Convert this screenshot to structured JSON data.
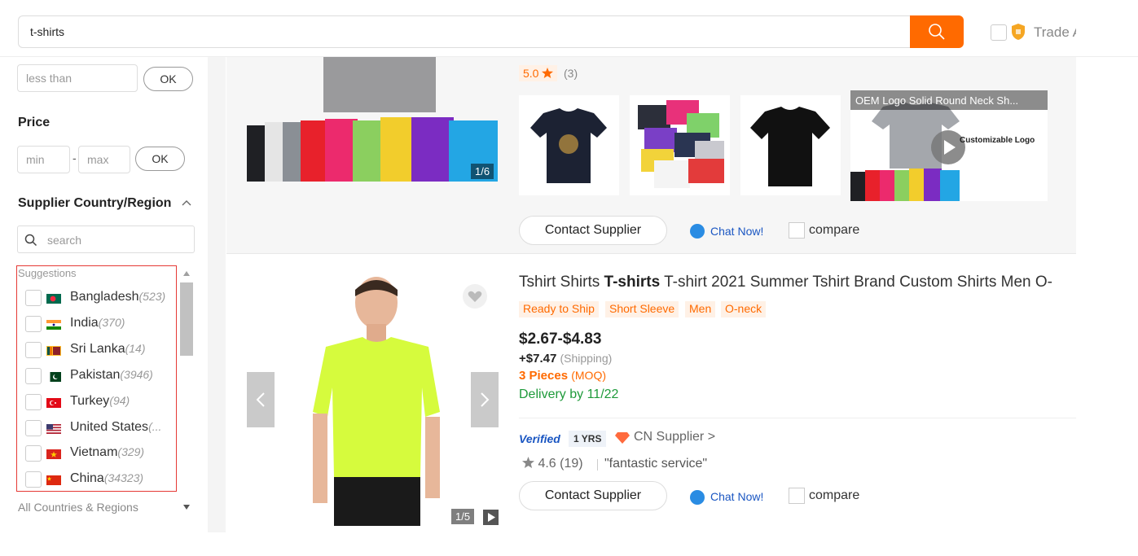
{
  "search": {
    "value": "t-shirts"
  },
  "trade_assurance": {
    "label": "Trade A"
  },
  "sidebar": {
    "min_order_placeholder": "less than",
    "ok_label": "OK",
    "price_title": "Price",
    "min_placeholder": "min",
    "max_placeholder": "max",
    "dash": "-",
    "country_title": "Supplier Country/Region",
    "country_search_placeholder": "search",
    "suggestions_title": "Suggestions",
    "countries": [
      {
        "name": "Bangladesh",
        "count": "(523)",
        "flag": "bangladesh"
      },
      {
        "name": "India",
        "count": "(370)",
        "flag": "india"
      },
      {
        "name": "Sri Lanka",
        "count": "(14)",
        "flag": "sri-lanka"
      },
      {
        "name": "Pakistan",
        "count": "(3946)",
        "flag": "pakistan"
      },
      {
        "name": "Turkey",
        "count": "(94)",
        "flag": "turkey"
      },
      {
        "name": "United States",
        "count": "(...",
        "flag": "united-states"
      },
      {
        "name": "Vietnam",
        "count": "(329)",
        "flag": "vietnam"
      },
      {
        "name": "China",
        "count": "(34323)",
        "flag": "china"
      }
    ],
    "all_countries": "All Countries & Regions"
  },
  "listing1": {
    "rating": "5.0",
    "rating_count": "(3)",
    "image_counter": "1/6",
    "video_title": "OEM Logo Solid Round Neck Sh...",
    "video_caption": "Customizable Logo",
    "contact_label": "Contact Supplier",
    "chat_label": "Chat Now!",
    "compare_label": "compare"
  },
  "listing2": {
    "title_pre": "Tshirt Shirts ",
    "title_bold": "T-shirts",
    "title_post": " T-shirt 2021 Summer Tshirt Brand Custom Shirts Men O-",
    "tags": [
      "Ready to Ship",
      "Short Sleeve",
      "Men",
      "O-neck"
    ],
    "price": "$2.67-$4.83",
    "shipping_value": "+$7.47",
    "shipping_label": "(Shipping)",
    "moq_value": "3 Pieces",
    "moq_label": "(MOQ)",
    "delivery": "Delivery by 11/22",
    "verified": "Verified",
    "years": "1 YRS",
    "supplier_type": "CN Supplier >",
    "rating": "4.6 (19)",
    "review": "\"fantastic service\"",
    "image_counter": "1/5",
    "contact_label": "Contact Supplier",
    "chat_label": "Chat Now!",
    "compare_label": "compare"
  },
  "colors": {
    "accent": "#ff6a00",
    "verified": "#1a56c2",
    "delivery": "#1e9a3a",
    "highlight_box": "#e53935"
  }
}
